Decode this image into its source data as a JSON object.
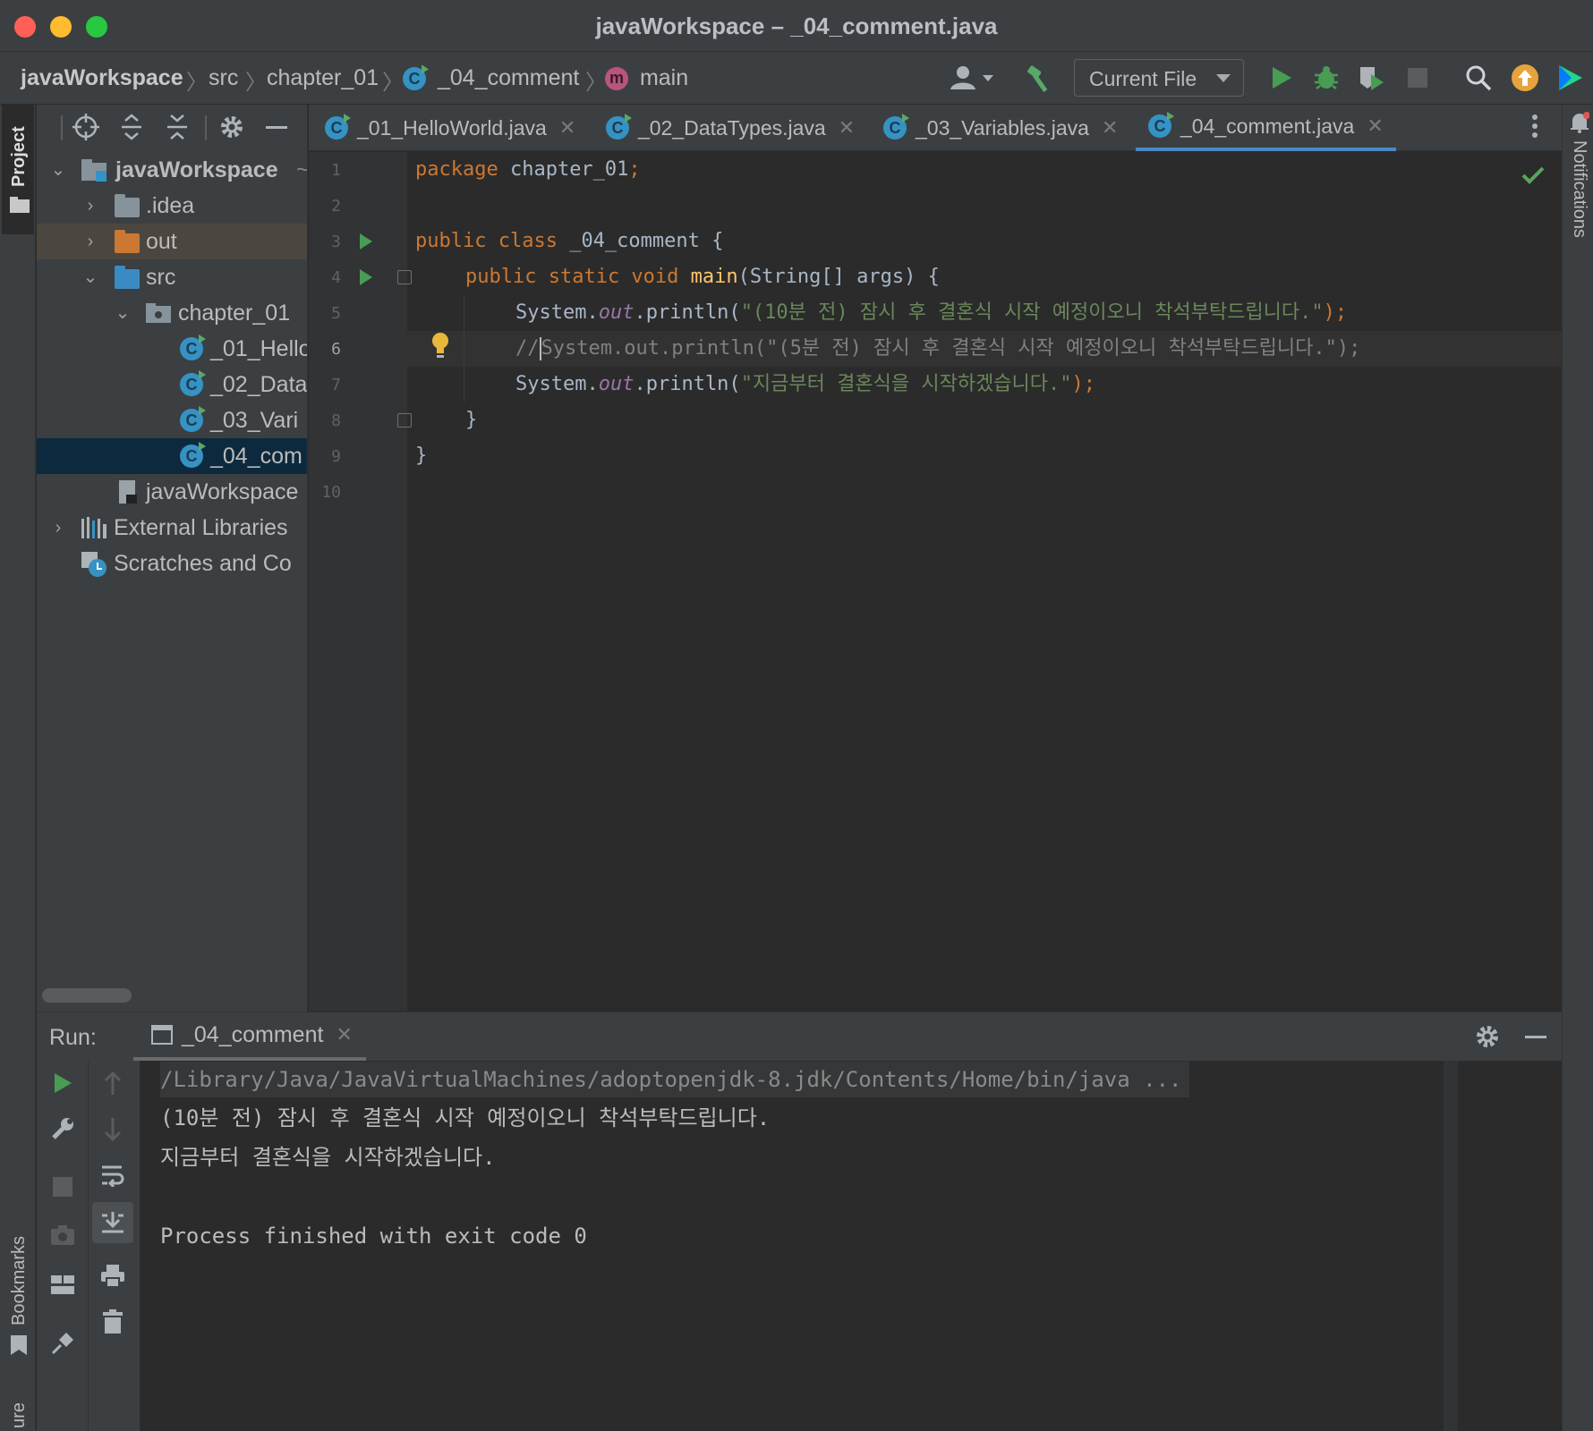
{
  "window": {
    "title": "javaWorkspace – _04_comment.java"
  },
  "breadcrumb": {
    "project": "javaWorkspace",
    "src": "src",
    "package": "chapter_01",
    "class": "_04_comment",
    "method": "main",
    "method_icon_letter": "m",
    "class_icon_letter": "C"
  },
  "toolbar": {
    "run_config": "Current File"
  },
  "side": {
    "project_label": "Project",
    "bookmarks_label": "Bookmarks",
    "structure_label": "ure",
    "notifications_label": "Notifications"
  },
  "tree": {
    "root": "javaWorkspace",
    "root_suffix": "~",
    "idea": ".idea",
    "out": "out",
    "src": "src",
    "chapter": "chapter_01",
    "files": [
      "_01_Hello",
      "_02_Data",
      "_03_Vari",
      "_04_com"
    ],
    "iml": "javaWorkspace",
    "ext_libs": "External Libraries",
    "scratches": "Scratches and Co"
  },
  "tabs": [
    {
      "label": "_01_HelloWorld.java",
      "active": false
    },
    {
      "label": "_02_DataTypes.java",
      "active": false
    },
    {
      "label": "_03_Variables.java",
      "active": false
    },
    {
      "label": "_04_comment.java",
      "active": true
    }
  ],
  "code": {
    "line_numbers": [
      "1",
      "2",
      "3",
      "4",
      "5",
      "6",
      "7",
      "8",
      "9",
      "10"
    ],
    "l1_kw": "package",
    "l1_rest": " chapter_01",
    "l1_semi": ";",
    "l3_kw": "public class",
    "l3_rest": " _04_comment {",
    "l4_kw": "public static void",
    "l4_fn": "main",
    "l4_rest": "(String[] args) {",
    "l5_a": "System.",
    "l5_out": "out",
    "l5_b": ".println(",
    "l5_str": "\"(10분 전) 잠시 후 결혼식 시작 예정이오니 착석부탁드립니다.\"",
    "l5_c": ");",
    "l6_comment_prefix": "//",
    "l6_comment_rest": "System.out.println(\"(5분 전) 잠시 후 결혼식 시작 예정이오니 착석부탁드립니다.\");",
    "l7_a": "System.",
    "l7_out": "out",
    "l7_b": ".println(",
    "l7_str": "\"지금부터 결혼식을 시작하겠습니다.\"",
    "l7_c": ");",
    "l8": "}",
    "l9": "}"
  },
  "run": {
    "label": "Run:",
    "tab": "_04_comment",
    "console": [
      "/Library/Java/JavaVirtualMachines/adoptopenjdk-8.jdk/Contents/Home/bin/java ...",
      "(10분 전) 잠시 후 결혼식 시작 예정이오니 착석부탁드립니다.",
      "지금부터 결혼식을 시작하겠습니다.",
      "",
      "Process finished with exit code 0"
    ]
  },
  "colors": {
    "keyword": "#cc7832",
    "string": "#6a8759",
    "function": "#ffc66d",
    "field": "#9876aa",
    "comment": "#808080",
    "accent": "#4a88c7"
  }
}
